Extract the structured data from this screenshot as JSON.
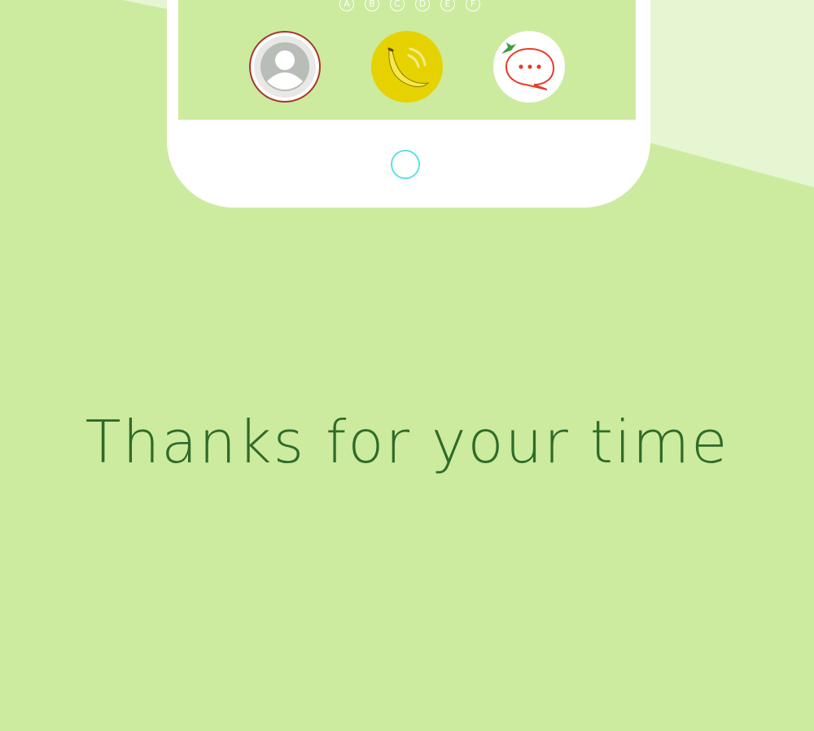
{
  "phone": {
    "dot_letters": [
      "A",
      "B",
      "C",
      "D",
      "E",
      "F"
    ],
    "apps": [
      {
        "icon": "user-avatar-icon"
      },
      {
        "icon": "banana-icon"
      },
      {
        "icon": "chat-bubble-icon"
      }
    ],
    "home_button_icon": "home-button-circle"
  },
  "message": {
    "text": "Thanks for your time"
  },
  "colors": {
    "background": "#cceb9f",
    "background_light": "#e6f6d2",
    "text": "#2f6b2a",
    "home_ring": "#5fe0e6",
    "banana_yellow": "#e6d200",
    "chat_red": "#e83b2b"
  }
}
